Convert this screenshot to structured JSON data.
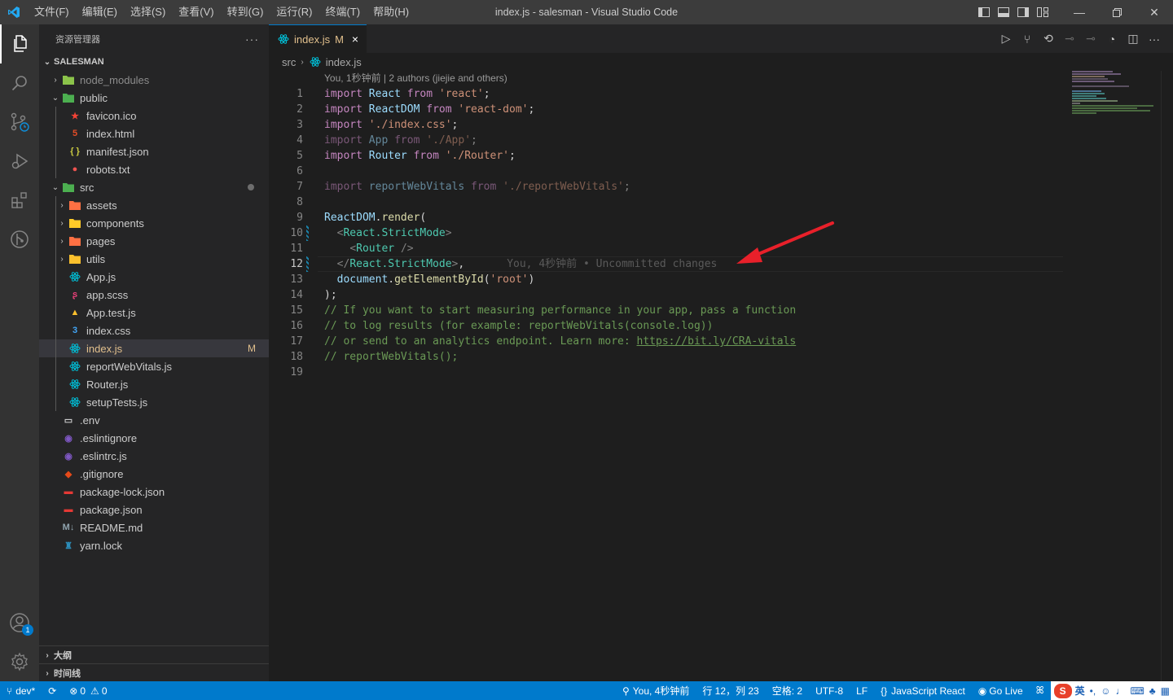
{
  "window": {
    "title": "index.js - salesman - Visual Studio Code",
    "menu": [
      "文件(F)",
      "编辑(E)",
      "选择(S)",
      "查看(V)",
      "转到(G)",
      "运行(R)",
      "终端(T)",
      "帮助(H)"
    ]
  },
  "sidebar": {
    "title": "资源管理器",
    "more": "···",
    "project": "SALESMAN",
    "tree": [
      {
        "label": "node_modules",
        "type": "folder",
        "icon": "folder-node-icon",
        "color": "#8bc34a",
        "depth": 0,
        "open": false,
        "dim": true
      },
      {
        "label": "public",
        "type": "folder",
        "icon": "folder-public-icon",
        "color": "#4caf50",
        "depth": 0,
        "open": true
      },
      {
        "label": "favicon.ico",
        "type": "file",
        "icon": "favicon-icon",
        "color": "#f44336",
        "depth": 1
      },
      {
        "label": "index.html",
        "type": "file",
        "icon": "html-icon",
        "color": "#e44d26",
        "depth": 1
      },
      {
        "label": "manifest.json",
        "type": "file",
        "icon": "json-icon",
        "color": "#cbcb41",
        "depth": 1
      },
      {
        "label": "robots.txt",
        "type": "file",
        "icon": "robot-icon",
        "color": "#ef5350",
        "depth": 1
      },
      {
        "label": "src",
        "type": "folder",
        "icon": "folder-src-icon",
        "color": "#4caf50",
        "depth": 0,
        "open": true,
        "dot": true
      },
      {
        "label": "assets",
        "type": "folder",
        "icon": "folder-assets-icon",
        "color": "#ff7043",
        "depth": 1,
        "open": false
      },
      {
        "label": "components",
        "type": "folder",
        "icon": "folder-components-icon",
        "color": "#ffca28",
        "depth": 1,
        "open": false
      },
      {
        "label": "pages",
        "type": "folder",
        "icon": "folder-pages-icon",
        "color": "#ff7043",
        "depth": 1,
        "open": false
      },
      {
        "label": "utils",
        "type": "folder",
        "icon": "folder-utils-icon",
        "color": "#fbc02d",
        "depth": 1,
        "open": false
      },
      {
        "label": "App.js",
        "type": "file",
        "icon": "react-icon",
        "color": "#00bcd4",
        "depth": 1
      },
      {
        "label": "app.scss",
        "type": "file",
        "icon": "sass-icon",
        "color": "#ec407a",
        "depth": 1
      },
      {
        "label": "App.test.js",
        "type": "file",
        "icon": "test-js-icon",
        "color": "#fbc02d",
        "depth": 1
      },
      {
        "label": "index.css",
        "type": "file",
        "icon": "css-icon",
        "color": "#42a5f5",
        "depth": 1
      },
      {
        "label": "index.js",
        "type": "file",
        "icon": "react-icon",
        "color": "#00bcd4",
        "depth": 1,
        "selected": true,
        "status": "M"
      },
      {
        "label": "reportWebVitals.js",
        "type": "file",
        "icon": "react-icon",
        "color": "#00bcd4",
        "depth": 1
      },
      {
        "label": "Router.js",
        "type": "file",
        "icon": "react-icon",
        "color": "#00bcd4",
        "depth": 1
      },
      {
        "label": "setupTests.js",
        "type": "file",
        "icon": "react-icon",
        "color": "#00bcd4",
        "depth": 1
      },
      {
        "label": ".env",
        "type": "file",
        "icon": "env-icon",
        "color": "#cccccc",
        "depth": 0
      },
      {
        "label": ".eslintignore",
        "type": "file",
        "icon": "eslint-icon",
        "color": "#7e57c2",
        "depth": 0
      },
      {
        "label": ".eslintrc.js",
        "type": "file",
        "icon": "eslint-icon",
        "color": "#7e57c2",
        "depth": 0
      },
      {
        "label": ".gitignore",
        "type": "file",
        "icon": "git-icon",
        "color": "#e64a19",
        "depth": 0
      },
      {
        "label": "package-lock.json",
        "type": "file",
        "icon": "npm-icon",
        "color": "#e53935",
        "depth": 0
      },
      {
        "label": "package.json",
        "type": "file",
        "icon": "npm-icon",
        "color": "#e53935",
        "depth": 0
      },
      {
        "label": "README.md",
        "type": "file",
        "icon": "markdown-icon",
        "color": "#90a4ae",
        "depth": 0
      },
      {
        "label": "yarn.lock",
        "type": "file",
        "icon": "yarn-icon",
        "color": "#2c8ebb",
        "depth": 0
      }
    ],
    "outline": "大纲",
    "timeline": "时间线"
  },
  "activity": {
    "account_badge": "1"
  },
  "editor": {
    "tab": {
      "label": "index.js",
      "status": "M",
      "close": "×"
    },
    "breadcrumb": [
      "src",
      "index.js"
    ],
    "codelens": "You, 1秒钟前 | 2 authors (jiejie and others)",
    "lines": [
      {
        "n": "1",
        "tokens": [
          [
            "kw2",
            "import"
          ],
          [
            "pun",
            " "
          ],
          [
            "id",
            "React"
          ],
          [
            "pun",
            " "
          ],
          [
            "kw2",
            "from"
          ],
          [
            "pun",
            " "
          ],
          [
            "str",
            "'react'"
          ],
          [
            "pun",
            ";"
          ]
        ]
      },
      {
        "n": "2",
        "tokens": [
          [
            "kw2",
            "import"
          ],
          [
            "pun",
            " "
          ],
          [
            "id",
            "ReactDOM"
          ],
          [
            "pun",
            " "
          ],
          [
            "kw2",
            "from"
          ],
          [
            "pun",
            " "
          ],
          [
            "str",
            "'react-dom'"
          ],
          [
            "pun",
            ";"
          ]
        ]
      },
      {
        "n": "3",
        "tokens": [
          [
            "kw2",
            "import"
          ],
          [
            "pun",
            " "
          ],
          [
            "str",
            "'./index.css'"
          ],
          [
            "pun",
            ";"
          ]
        ]
      },
      {
        "n": "4",
        "dim": true,
        "tokens": [
          [
            "kw2",
            "import"
          ],
          [
            "pun",
            " "
          ],
          [
            "id",
            "App"
          ],
          [
            "pun",
            " "
          ],
          [
            "kw2",
            "from"
          ],
          [
            "pun",
            " "
          ],
          [
            "str",
            "'./App'"
          ],
          [
            "pun",
            ";"
          ]
        ]
      },
      {
        "n": "5",
        "tokens": [
          [
            "kw2",
            "import"
          ],
          [
            "pun",
            " "
          ],
          [
            "id",
            "Router"
          ],
          [
            "pun",
            " "
          ],
          [
            "kw2",
            "from"
          ],
          [
            "pun",
            " "
          ],
          [
            "str",
            "'./Router'"
          ],
          [
            "pun",
            ";"
          ]
        ]
      },
      {
        "n": "6",
        "tokens": []
      },
      {
        "n": "7",
        "dim": true,
        "tokens": [
          [
            "kw2",
            "import"
          ],
          [
            "pun",
            " "
          ],
          [
            "id",
            "reportWebVitals"
          ],
          [
            "pun",
            " "
          ],
          [
            "kw2",
            "from"
          ],
          [
            "pun",
            " "
          ],
          [
            "str",
            "'./reportWebVitals'"
          ],
          [
            "pun",
            ";"
          ]
        ]
      },
      {
        "n": "8",
        "tokens": []
      },
      {
        "n": "9",
        "tokens": [
          [
            "id",
            "ReactDOM"
          ],
          [
            "pun",
            "."
          ],
          [
            "fn",
            "render"
          ],
          [
            "pun",
            "("
          ]
        ]
      },
      {
        "n": "10",
        "mark": true,
        "tokens": [
          [
            "pun",
            "  "
          ],
          [
            "br",
            "<"
          ],
          [
            "tag",
            "React.StrictMode"
          ],
          [
            "br",
            ">"
          ]
        ]
      },
      {
        "n": "11",
        "tokens": [
          [
            "pun",
            "    "
          ],
          [
            "br",
            "<"
          ],
          [
            "tag",
            "Router"
          ],
          [
            "pun",
            " "
          ],
          [
            "br",
            "/>"
          ]
        ]
      },
      {
        "n": "12",
        "mark": true,
        "current": true,
        "tokens": [
          [
            "pun",
            "  "
          ],
          [
            "br",
            "</"
          ],
          [
            "tag",
            "React.StrictMode"
          ],
          [
            "br",
            ">"
          ],
          [
            "pun",
            ","
          ]
        ],
        "ghost": "You, 4秒钟前 • Uncommitted changes"
      },
      {
        "n": "13",
        "tokens": [
          [
            "pun",
            "  "
          ],
          [
            "id",
            "document"
          ],
          [
            "pun",
            "."
          ],
          [
            "fn",
            "getElementById"
          ],
          [
            "pun",
            "("
          ],
          [
            "str",
            "'root'"
          ],
          [
            "pun",
            ")"
          ]
        ]
      },
      {
        "n": "14",
        "tokens": [
          [
            "pun",
            ")"
          ],
          [
            "pun",
            ";"
          ]
        ]
      },
      {
        "n": "15",
        "tokens": [
          [
            "com",
            "// If you want to start measuring performance in your app, pass a function"
          ]
        ]
      },
      {
        "n": "16",
        "tokens": [
          [
            "com",
            "// to log results (for example: reportWebVitals(console.log))"
          ]
        ]
      },
      {
        "n": "17",
        "tokens": [
          [
            "com",
            "// or send to an analytics endpoint. Learn more: "
          ],
          [
            "link",
            "https://bit.ly/CRA-vitals"
          ]
        ]
      },
      {
        "n": "18",
        "tokens": [
          [
            "com",
            "// reportWebVitals();"
          ]
        ]
      },
      {
        "n": "19",
        "tokens": []
      }
    ]
  },
  "statusbar": {
    "branch": "dev*",
    "errors": "0",
    "warnings": "0",
    "blame": "You, 4秒钟前",
    "position": "行 12，列 23",
    "spaces": "空格: 2",
    "encoding": "UTF-8",
    "eol": "LF",
    "language": "JavaScript React",
    "golive": "Go Live",
    "ime": "英"
  },
  "colors": {
    "accent": "#007acc",
    "annotation_arrow": "#e8202a"
  }
}
